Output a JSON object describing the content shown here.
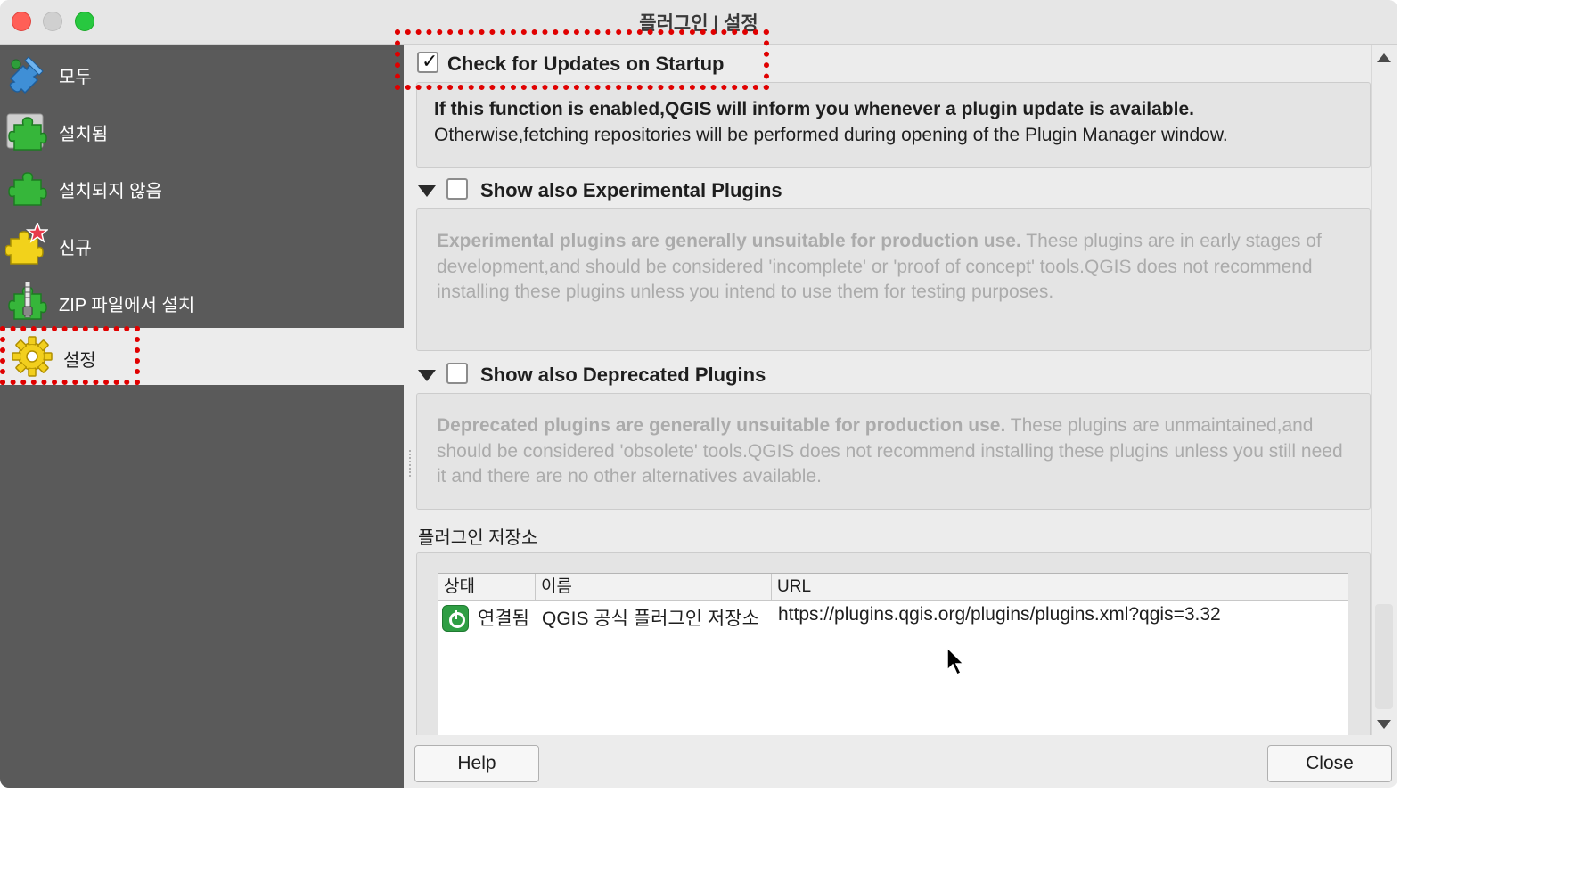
{
  "window": {
    "title": "플러그인 | 설정",
    "close_glyph": "×"
  },
  "sidebar": {
    "items": [
      {
        "label": "모두",
        "icon": "puzzle-blue-icon"
      },
      {
        "label": "설치됨",
        "icon": "puzzle-green-installed-icon"
      },
      {
        "label": "설치되지 않음",
        "icon": "puzzle-green-icon"
      },
      {
        "label": "신규",
        "icon": "puzzle-yellow-new-icon"
      },
      {
        "label": "ZIP 파일에서 설치",
        "icon": "puzzle-zip-icon"
      },
      {
        "label": "설정",
        "icon": "gear-icon",
        "selected": true
      }
    ]
  },
  "settings": {
    "check_updates": {
      "label": "Check for Updates on Startup",
      "checked": true,
      "check_glyph": "✓",
      "desc_bold": "If this function is enabled,QGIS will inform you whenever a plugin update is available.",
      "desc": "Otherwise,fetching repositories will be performed during opening of the Plugin Manager window."
    },
    "experimental": {
      "label": "Show also Experimental Plugins",
      "checked": false,
      "desc_bold": "Experimental plugins are generally unsuitable for production use.",
      "desc": " These plugins are in early stages of development,and should be considered 'incomplete' or 'proof of concept' tools.QGIS does not recommend installing these plugins unless you intend to use them for testing purposes."
    },
    "deprecated": {
      "label": "Show also Deprecated Plugins",
      "checked": false,
      "desc_bold": "Deprecated plugins are generally unsuitable for production use.",
      "desc": " These plugins are unmaintained,and should be considered 'obsolete' tools.QGIS does not recommend installing these plugins unless you still need it and there are no other alternatives available."
    }
  },
  "repositories": {
    "title": "플러그인 저장소",
    "columns": [
      "상태",
      "이름",
      "URL"
    ],
    "rows": [
      {
        "status": "연결됨",
        "name": "QGIS 공식 플러그인 저장소",
        "url": "https://plugins.qgis.org/plugins/plugins.xml?qgis=3.32"
      }
    ]
  },
  "footer": {
    "help_label": "Help",
    "close_label": "Close"
  },
  "colors": {
    "highlight_dashes": "#e00000",
    "sidebar_bg": "#5a5a5a"
  }
}
